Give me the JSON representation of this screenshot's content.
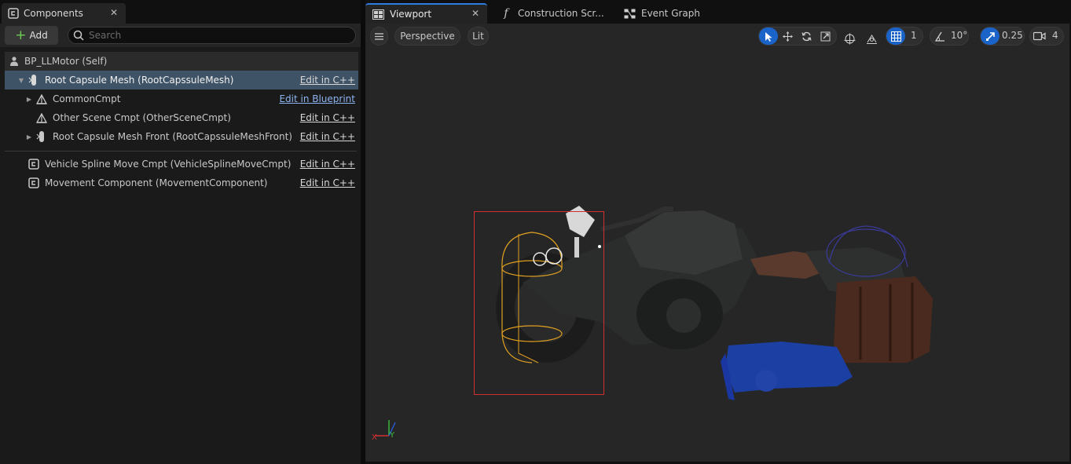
{
  "left_panel": {
    "tab_title": "Components",
    "add_label": "Add",
    "search_placeholder": "Search",
    "rows": [
      {
        "label": "BP_LLMotor (Self)",
        "action": ""
      },
      {
        "label": "Root Capsule Mesh (RootCapssuleMesh)",
        "action": "Edit in C++"
      },
      {
        "label": "CommonCmpt",
        "action": "Edit in Blueprint"
      },
      {
        "label": "Other Scene Cmpt (OtherSceneCmpt)",
        "action": "Edit in C++"
      },
      {
        "label": "Root Capsule Mesh Front (RootCapssuleMeshFront)",
        "action": "Edit in C++"
      },
      {
        "label": "Vehicle Spline Move Cmpt (VehicleSplineMoveCmpt)",
        "action": "Edit in C++"
      },
      {
        "label": "Movement Component (MovementComponent)",
        "action": "Edit in C++"
      }
    ]
  },
  "editor": {
    "tabs": [
      "Viewport",
      "Construction Scr...",
      "Event Graph"
    ],
    "toolbar": {
      "perspective": "Perspective",
      "lit": "Lit",
      "grid_snap": "1",
      "rotation_snap": "10°",
      "scale_snap": "0.25",
      "camera_speed": "4"
    },
    "axis_labels": {
      "x": "X",
      "y": "Y"
    }
  },
  "colors": {
    "selection_highlight": "#3f5367",
    "accent": "#1a63c8",
    "selection_box": "#d03030",
    "capsule_wire": "#e0a020"
  }
}
